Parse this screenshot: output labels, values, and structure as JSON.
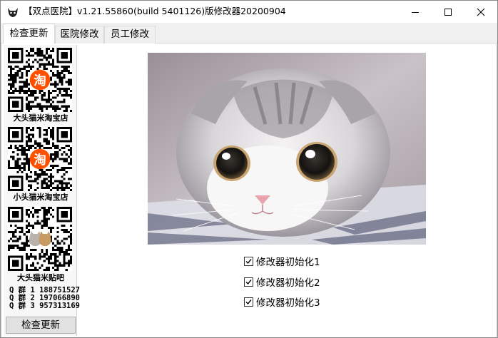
{
  "window": {
    "title": "【双点医院】v1.21.55860(build 5401126)版修改器20200904",
    "controls": {
      "minimize_icon": "minimize-icon",
      "maximize_icon": "maximize-icon",
      "close_icon": "close-icon"
    }
  },
  "tabs": [
    {
      "label": "检查更新",
      "active": true
    },
    {
      "label": "医院修改",
      "active": false
    },
    {
      "label": "员工修改",
      "active": false
    }
  ],
  "sidebar": {
    "qr_codes": [
      {
        "label": "大头猫米淘宝店",
        "badge": "淘"
      },
      {
        "label": "小头猫米淘宝店",
        "badge": "淘"
      },
      {
        "label": "大头猫米贴吧",
        "badge": "cats"
      }
    ],
    "qq_groups": [
      "Q 群 1 188751527",
      "Q 群 2 197066890",
      "Q 群 3 957313169"
    ],
    "check_button": "检查更新"
  },
  "main": {
    "image": "cat-photo",
    "checkboxes": [
      {
        "label": "修改器初始化1",
        "checked": true
      },
      {
        "label": "修改器初始化2",
        "checked": true
      },
      {
        "label": "修改器初始化3",
        "checked": true
      }
    ]
  },
  "colors": {
    "tab_border": "#d9d9d9",
    "button_bg": "#e1e1e1",
    "taobao_orange": "#ff5000"
  }
}
